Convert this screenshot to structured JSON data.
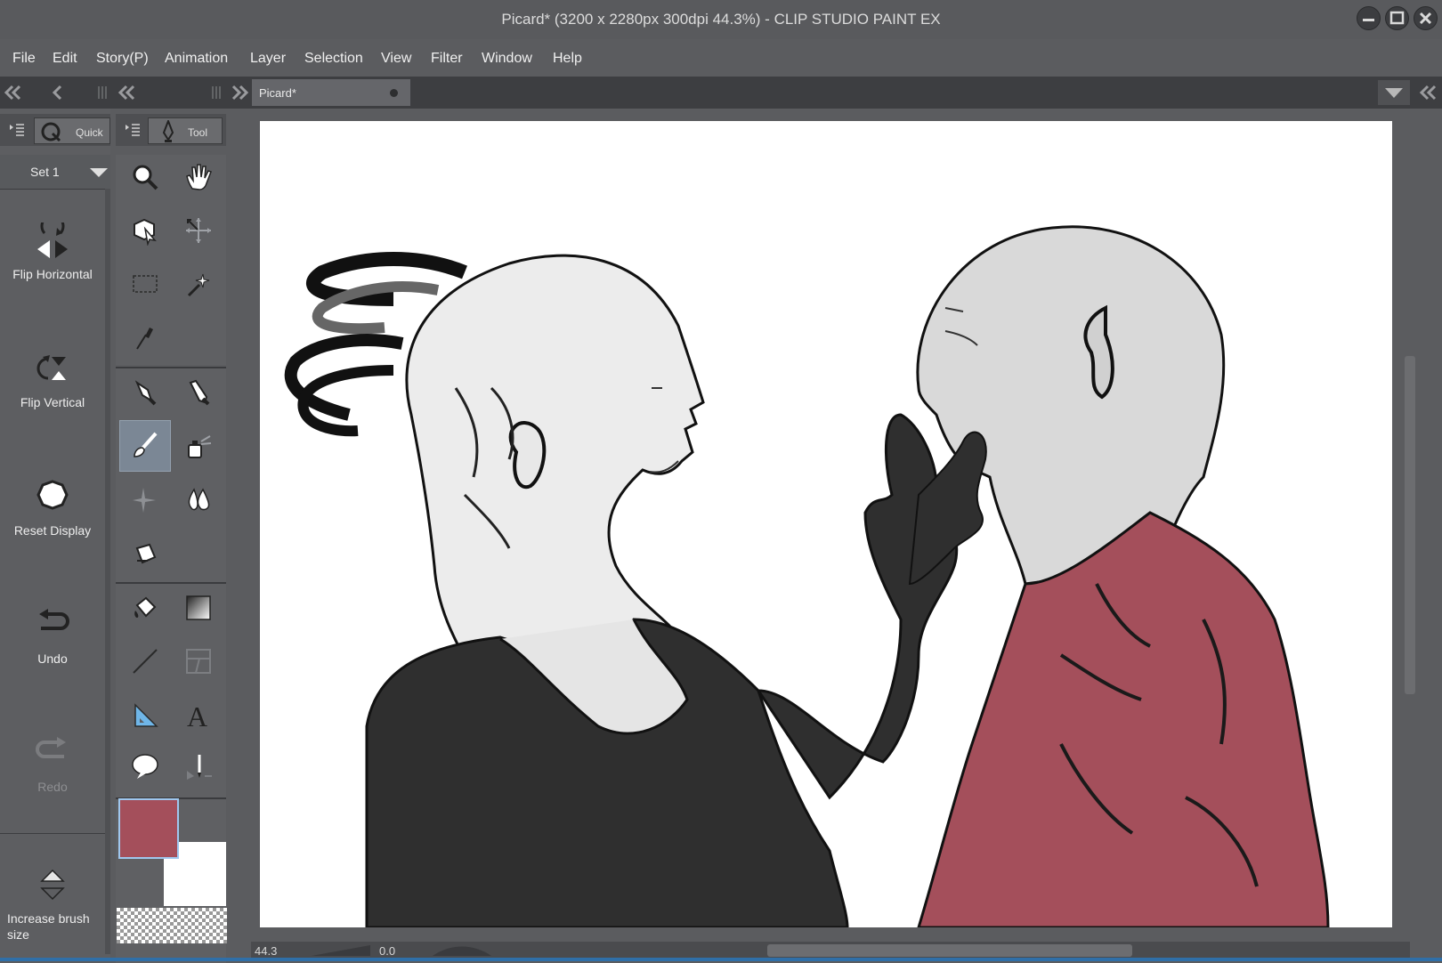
{
  "window": {
    "title": "Picard* (3200 x 2280px 300dpi 44.3%)  - CLIP STUDIO PAINT EX"
  },
  "menu": [
    "File",
    "Edit",
    "Story(P)",
    "Animation",
    "Layer",
    "Selection",
    "View",
    "Filter",
    "Window",
    "Help"
  ],
  "document_tab": {
    "label": "Picard*"
  },
  "quick_access": {
    "tab_label": "Quick",
    "set_label": "Set 1",
    "items": [
      {
        "label": "Flip Horizontal",
        "icon": "flip-horizontal-icon",
        "enabled": true
      },
      {
        "label": "Flip Vertical",
        "icon": "flip-vertical-icon",
        "enabled": true
      },
      {
        "label": "Reset Display",
        "icon": "reset-display-icon",
        "enabled": true
      },
      {
        "label": "Undo",
        "icon": "undo-icon",
        "enabled": true
      },
      {
        "label": "Redo",
        "icon": "redo-icon",
        "enabled": false
      },
      {
        "label": "Increase brush size",
        "icon": "brush-size-icon",
        "enabled": true
      }
    ]
  },
  "tool_panel": {
    "tab_label": "Tool",
    "tools": [
      {
        "name": "zoom-tool",
        "icon": "magnifier-icon"
      },
      {
        "name": "hand-tool",
        "icon": "hand-icon"
      },
      {
        "name": "object-tool",
        "icon": "object-cursor-icon"
      },
      {
        "name": "move-layer-tool",
        "icon": "move-arrows-icon"
      },
      {
        "name": "selection-tool",
        "icon": "marquee-icon"
      },
      {
        "name": "auto-select-tool",
        "icon": "magic-wand-icon"
      },
      {
        "name": "eyedropper-tool",
        "icon": "eyedropper-icon"
      },
      {
        "name": "pen-tool",
        "icon": "pen-nib-icon"
      },
      {
        "name": "pencil-tool",
        "icon": "pencil-icon"
      },
      {
        "name": "brush-tool",
        "icon": "brush-icon",
        "selected": true
      },
      {
        "name": "airbrush-tool",
        "icon": "airbrush-icon"
      },
      {
        "name": "decoration-tool",
        "icon": "sparkle-icon"
      },
      {
        "name": "blend-tool",
        "icon": "blend-drop-icon"
      },
      {
        "name": "eraser-tool",
        "icon": "eraser-icon"
      },
      {
        "name": "fill-tool",
        "icon": "paint-bucket-icon"
      },
      {
        "name": "gradient-tool",
        "icon": "gradient-icon"
      },
      {
        "name": "figure-tool",
        "icon": "line-icon"
      },
      {
        "name": "frame-border-tool",
        "icon": "frame-border-icon"
      },
      {
        "name": "ruler-tool",
        "icon": "ruler-triangle-icon"
      },
      {
        "name": "text-tool",
        "icon": "text-A-icon"
      },
      {
        "name": "balloon-tool",
        "icon": "speech-balloon-icon"
      },
      {
        "name": "correct-line-tool",
        "icon": "correct-line-icon"
      }
    ]
  },
  "colors": {
    "main_color": "#a44f5b",
    "sub_color": "#ffffff",
    "accent_selected": "#7b8795"
  },
  "status": {
    "zoom": "44.3",
    "rotation": "0.0"
  }
}
